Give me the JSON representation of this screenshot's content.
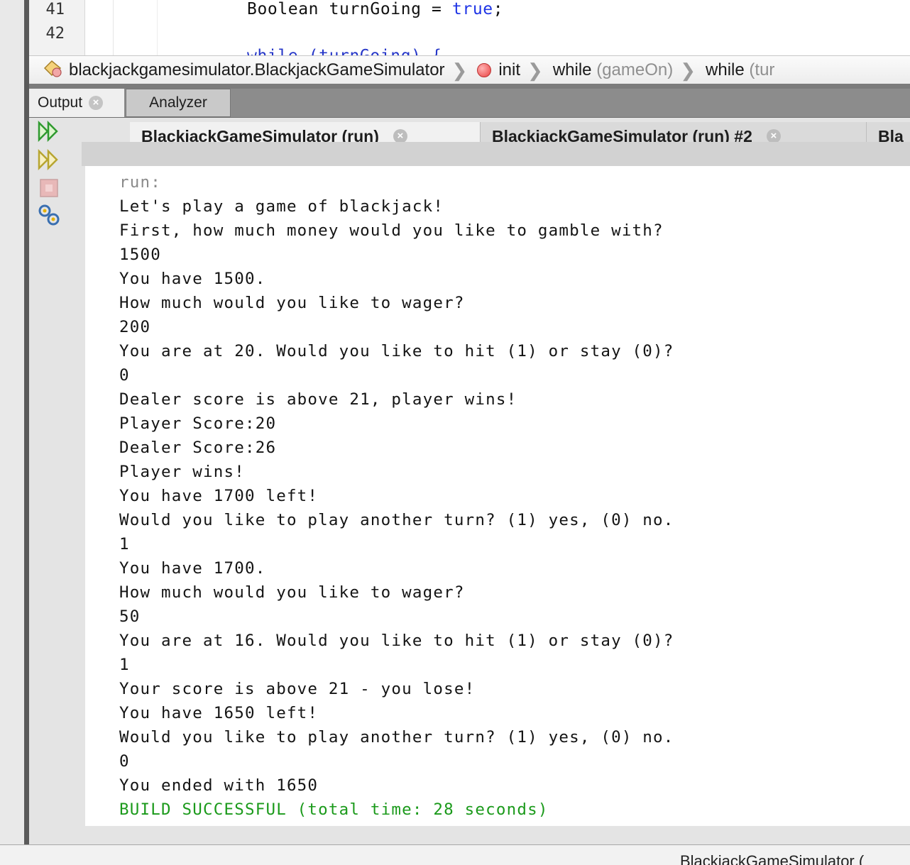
{
  "editor": {
    "lines": [
      {
        "number": "41",
        "code": "Boolean turnGoing = ",
        "keyword": "true",
        "tail": ";"
      },
      {
        "number": "42",
        "code": "",
        "keyword": "",
        "tail": ""
      }
    ],
    "partial_next": "while (turnGoing) {"
  },
  "breadcrumb": {
    "class_name": "blackjackgamesimulator.BlackjackGameSimulator",
    "method": "init",
    "loop1": "while",
    "loop1_cond": "(gameOn)",
    "loop2": "while",
    "loop2_cond": "(tur"
  },
  "panel_tabs": {
    "output": "Output",
    "analyzer": "Analyzer"
  },
  "run_tabs": [
    {
      "label": "BlackjackGameSimulator (run)"
    },
    {
      "label": "BlackjackGameSimulator (run) #2"
    },
    {
      "label": "Bla"
    }
  ],
  "console": {
    "run_label": "run:",
    "lines": [
      "Let's play a game of blackjack!",
      "First, how much money would you like to gamble with?",
      "1500",
      "You have 1500.",
      "How much would you like to wager?",
      "200",
      "You are at 20. Would you like to hit (1) or stay (0)?",
      "0",
      "Dealer score is above 21, player wins!",
      "Player Score:20",
      "Dealer Score:26",
      "Player wins!",
      "You have 1700 left!",
      "Would you like to play another turn? (1) yes, (0) no.",
      "1",
      "You have 1700.",
      "How much would you like to wager?",
      "50",
      "You are at 16. Would you like to hit (1) or stay (0)?",
      "1",
      "Your score is above 21 - you lose!",
      "You have 1650 left!",
      "Would you like to play another turn? (1) yes, (0) no.",
      "0",
      "You ended with 1650"
    ],
    "build_status": "BUILD SUCCESSFUL (total time: 28 seconds)"
  },
  "status_bar": {
    "text": "BlackjackGameSimulator ("
  },
  "colors": {
    "keyword": "#1f35e6",
    "success": "#1b9a1b",
    "run_label": "#8a8a8a"
  },
  "icons": {
    "rerun": "rerun-icon",
    "rerun_with_params": "rerun-params-icon",
    "stop": "stop-icon",
    "settings": "settings-icon"
  }
}
